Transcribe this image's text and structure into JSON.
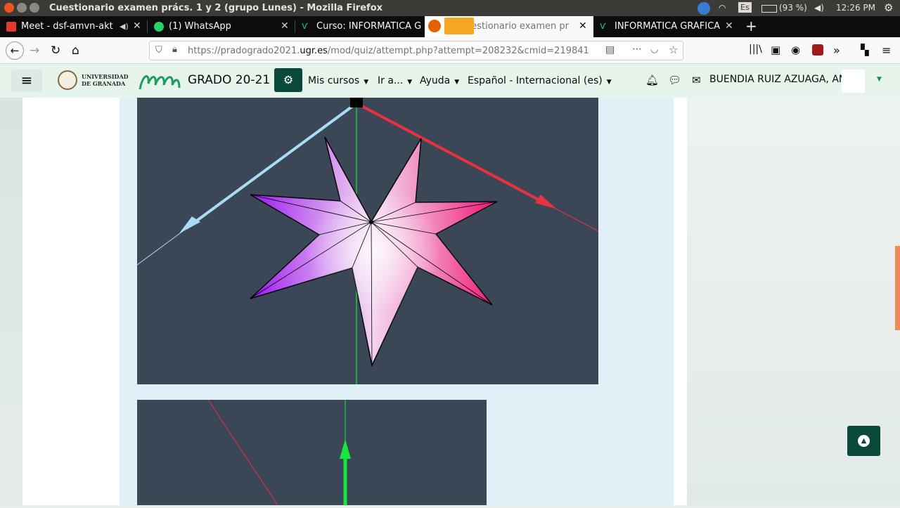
{
  "window": {
    "title": "Cuestionario examen prács. 1 y 2 (grupo Lunes) - Mozilla Firefox"
  },
  "tray": {
    "keyboard": "Es",
    "battery": "(93 %)",
    "time": "12:26 PM"
  },
  "tabs": [
    {
      "label": "Meet - dsf-amvn-akt",
      "active": false
    },
    {
      "label": "(1) WhatsApp",
      "active": false
    },
    {
      "label": "Curso: INFORMÁTICA G",
      "active": false
    },
    {
      "label": "uestionario examen pr",
      "active": true
    },
    {
      "label": "INFORMÁTICA GRÁFICA",
      "active": false
    }
  ],
  "url": {
    "prefix": "https://pradogrado2021.",
    "domain": "ugr.es",
    "path": "/mod/quiz/attempt.php?attempt=208232&cmid=219841"
  },
  "header": {
    "logo_line1": "UNIVERSIDAD",
    "logo_line2": "DE GRANADA",
    "site_title": "GRADO 20-21",
    "nav": [
      "Mis cursos",
      "Ir a...",
      "Ayuda",
      "Español - Internacional (es)"
    ],
    "user_name": "BUENDIA RUIZ AZUAGA, ANA"
  },
  "colors": {
    "accent": "#0b4a3a",
    "canvas_bg": "#3b4657",
    "axis_x": "#e8323f",
    "axis_y": "#19e63c",
    "axis_z": "#a9dcf5"
  },
  "icons": {
    "menu": "hamburger-icon",
    "gear": "gear-icon",
    "bell": "bell-icon",
    "chat": "chat-icon",
    "mail": "mail-icon",
    "to_top": "chevron-up-icon"
  }
}
